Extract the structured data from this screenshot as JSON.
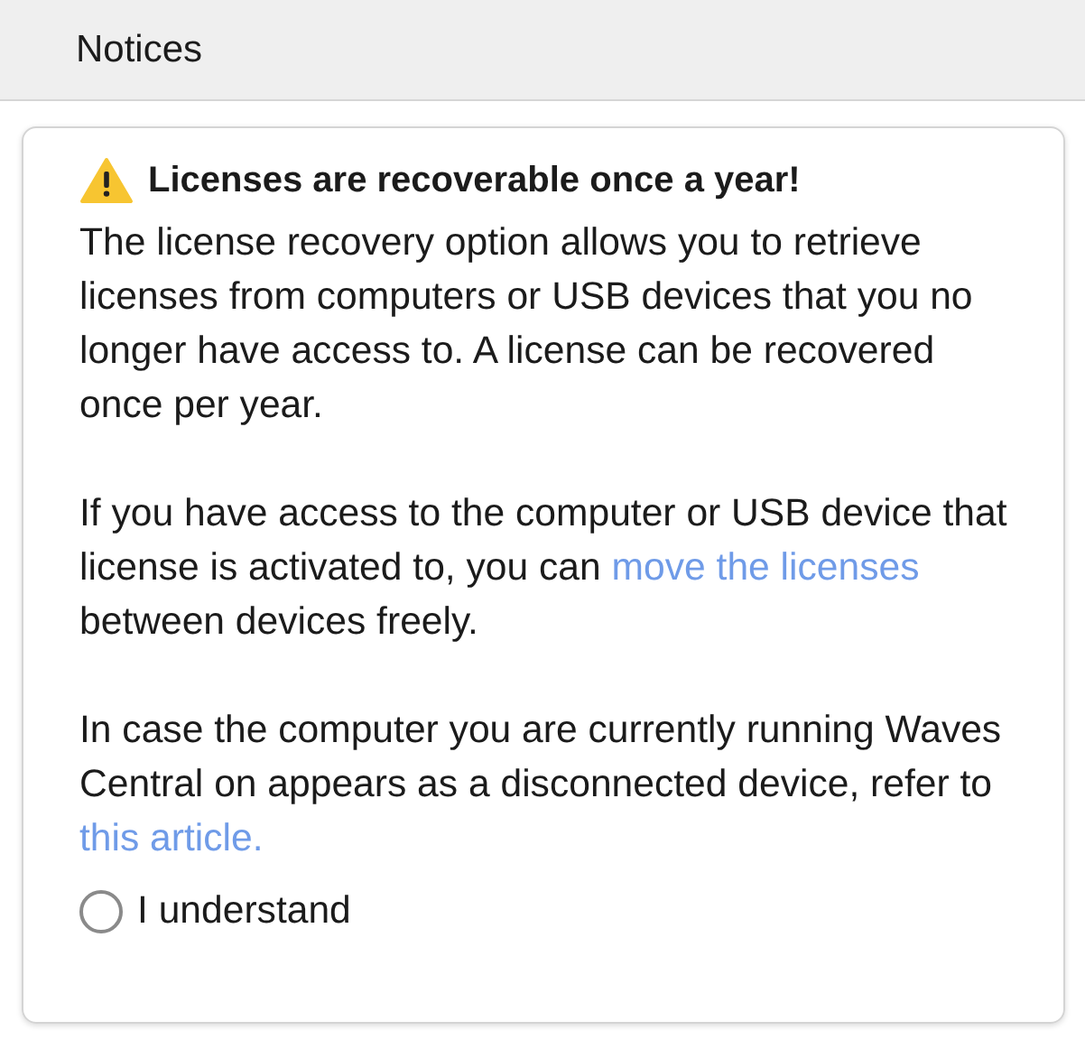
{
  "header": {
    "title": "Notices"
  },
  "notice": {
    "title": "Licenses are recoverable once a year!",
    "paragraphs": [
      {
        "parts": [
          {
            "kind": "text",
            "text": "The license recovery option allows you to retrieve licenses from computers or USB devices that you no longer have access to. A license can be recovered once per year."
          }
        ]
      },
      {
        "parts": [
          {
            "kind": "text",
            "text": "If you have access to the computer or USB device that license is activated to, you can "
          },
          {
            "kind": "link",
            "text": "move the licenses"
          },
          {
            "kind": "text",
            "text": " between devices freely."
          }
        ]
      },
      {
        "parts": [
          {
            "kind": "text",
            "text": "In case the computer you are currently running Waves Central on appears as a disconnected device, refer to "
          },
          {
            "kind": "link",
            "text": "this article."
          }
        ]
      }
    ],
    "confirm": {
      "label": "I understand",
      "checked": false
    }
  }
}
